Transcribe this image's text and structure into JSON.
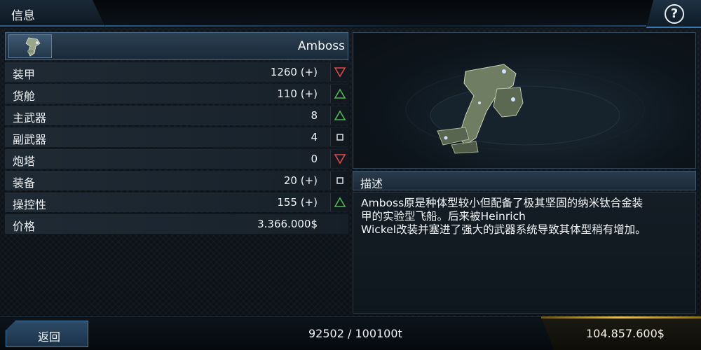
{
  "header": {
    "title": "信息",
    "help_icon": "help-icon"
  },
  "ship": {
    "name": "Amboss",
    "thumbnail_icon": "ship-icon",
    "stats": [
      {
        "label": "装甲",
        "value": "1260 (+)",
        "indicator": "down",
        "indicator_color": "#e04848"
      },
      {
        "label": "货舱",
        "value": "110 (+)",
        "indicator": "up",
        "indicator_color": "#4fb84f"
      },
      {
        "label": "主武器",
        "value": "8",
        "indicator": "up",
        "indicator_color": "#4fb84f"
      },
      {
        "label": "副武器",
        "value": "4",
        "indicator": "neutral",
        "indicator_color": "#cfd6dc"
      },
      {
        "label": "炮塔",
        "value": "0",
        "indicator": "down",
        "indicator_color": "#e04848"
      },
      {
        "label": "装备",
        "value": "20 (+)",
        "indicator": "neutral",
        "indicator_color": "#cfd6dc"
      },
      {
        "label": "操控性",
        "value": "155 (+)",
        "indicator": "up",
        "indicator_color": "#4fb84f"
      },
      {
        "label": "价格",
        "value": "3.366.000$",
        "indicator": "none",
        "indicator_color": ""
      }
    ]
  },
  "description": {
    "title": "描述",
    "text": "Amboss原是种体型较小但配备了极其坚固的纳米钛合金装\n甲的实验型飞船。后来被Heinrich\nWickel改装并塞进了强大的武器系统导致其体型稍有增加。"
  },
  "footer": {
    "back_label": "返回",
    "capacity": "92502 / 100100t",
    "credits": "104.857.600$"
  },
  "colors": {
    "accent": "#3b78ad",
    "credits_gold": "#c8a43a"
  }
}
